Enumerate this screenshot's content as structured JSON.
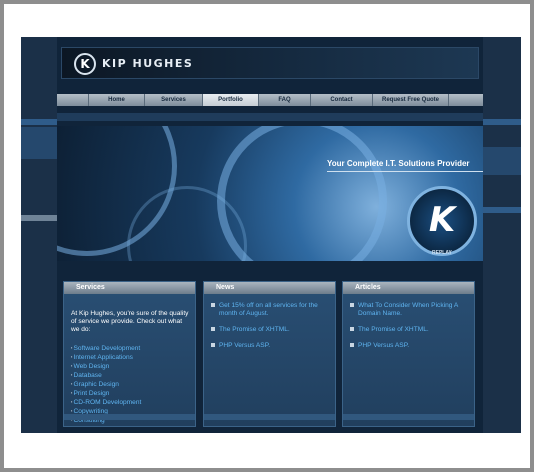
{
  "header": {
    "logo_letter": "K",
    "logo_text": "KIP HUGHES"
  },
  "nav": {
    "items": [
      {
        "label": "Home"
      },
      {
        "label": "Services"
      },
      {
        "label": "Portfolio"
      },
      {
        "label": "FAQ"
      },
      {
        "label": "Contact"
      },
      {
        "label": "Request Free Quote"
      }
    ],
    "active_index": 2
  },
  "banner": {
    "title": "Your Complete I.T. Solutions Provider",
    "badge_letter": "K",
    "replay_label": "REPLAY"
  },
  "columns": {
    "services": {
      "title": "Services",
      "intro": "At Kip Hughes, you're sure of the quality of service we provide. Check out what we do:",
      "items": [
        "Software Development",
        "Internet Applications",
        "Web Design",
        "Database",
        "Graphic Design",
        "Print Design",
        "CD-ROM Development",
        "Copywriting",
        "Consulting"
      ]
    },
    "news": {
      "title": "News",
      "items": [
        "Get 15% off on all services for the month of August.",
        "The Promise of XHTML.",
        "PHP Versus ASP."
      ]
    },
    "articles": {
      "title": "Articles",
      "items": [
        "What To Consider When Picking A Domain Name.",
        "The Promise of XHTML.",
        "PHP Versus ASP."
      ]
    }
  },
  "colors": {
    "page_bg": "#16283d",
    "link": "#5fb4f0",
    "accent_band": "#2f5c8a"
  }
}
